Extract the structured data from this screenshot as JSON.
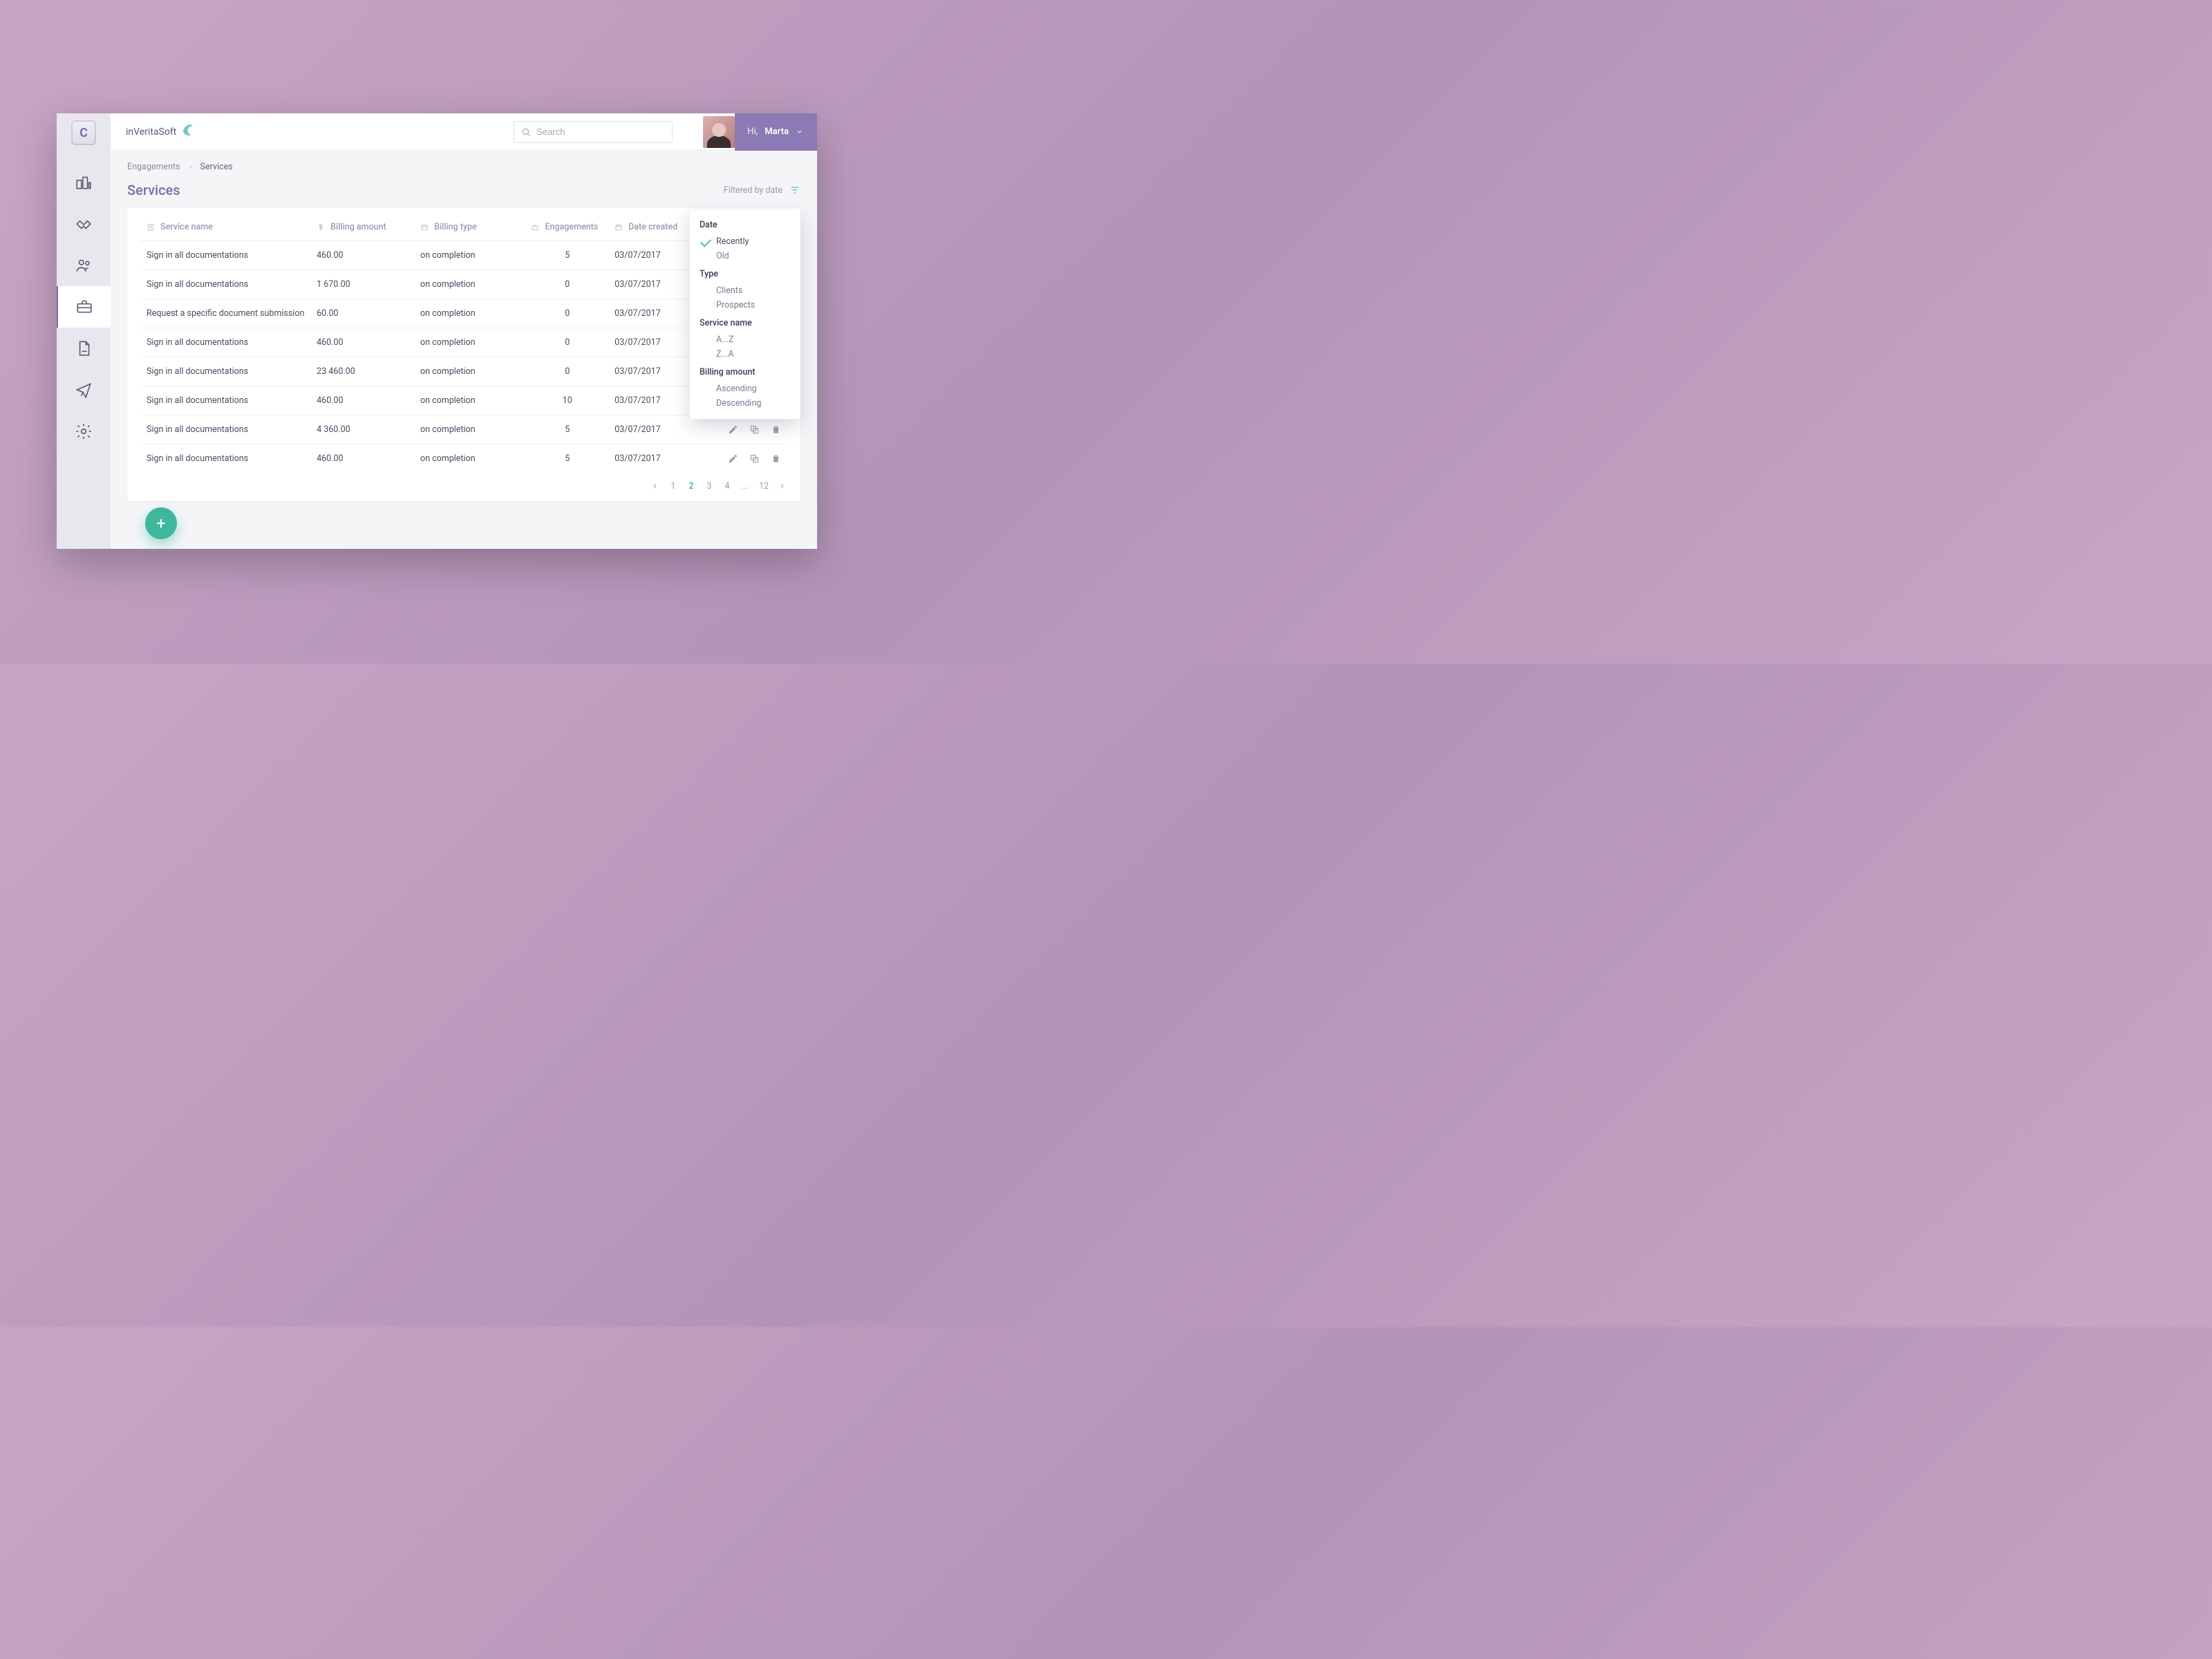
{
  "brand": {
    "name": "inVeritaSoft"
  },
  "search": {
    "placeholder": "Search"
  },
  "user": {
    "greeting": "Hi,",
    "name": "Marta"
  },
  "breadcrumb": {
    "parent": "Engagements",
    "current": "Services"
  },
  "page": {
    "title": "Services"
  },
  "filter": {
    "trigger_label": "Filtered by date",
    "groups": [
      {
        "label": "Date",
        "options": [
          "Recently",
          "Old"
        ],
        "selected": "Recently"
      },
      {
        "label": "Type",
        "options": [
          "Clients",
          "Prospects"
        ],
        "selected": null
      },
      {
        "label": "Service name",
        "options": [
          "A...Z",
          "Z...A"
        ],
        "selected": null
      },
      {
        "label": "Billing amount",
        "options": [
          "Ascending",
          "Descending"
        ],
        "selected": null
      }
    ]
  },
  "table": {
    "columns": {
      "service_name": "Service name",
      "billing_amount": "Billing amount",
      "billing_type": "Billing type",
      "engagements": "Engagements",
      "date_created": "Date created"
    },
    "rows": [
      {
        "service_name": "Sign in all documentations",
        "billing_amount": "460.00",
        "billing_type": "on completion",
        "engagements": "5",
        "date_created": "03/07/2017"
      },
      {
        "service_name": "Sign in all documentations",
        "billing_amount": "1 670.00",
        "billing_type": "on completion",
        "engagements": "0",
        "date_created": "03/07/2017"
      },
      {
        "service_name": "Request a specific document submission",
        "billing_amount": "60.00",
        "billing_type": "on completion",
        "engagements": "0",
        "date_created": "03/07/2017"
      },
      {
        "service_name": "Sign in all documentations",
        "billing_amount": "460.00",
        "billing_type": "on completion",
        "engagements": "0",
        "date_created": "03/07/2017"
      },
      {
        "service_name": "Sign in all documentations",
        "billing_amount": "23 460.00",
        "billing_type": "on completion",
        "engagements": "0",
        "date_created": "03/07/2017"
      },
      {
        "service_name": "Sign in all documentations",
        "billing_amount": "460.00",
        "billing_type": "on completion",
        "engagements": "10",
        "date_created": "03/07/2017"
      },
      {
        "service_name": "Sign in all documentations",
        "billing_amount": "4 360.00",
        "billing_type": "on completion",
        "engagements": "5",
        "date_created": "03/07/2017"
      },
      {
        "service_name": "Sign in all documentations",
        "billing_amount": "460.00",
        "billing_type": "on completion",
        "engagements": "5",
        "date_created": "03/07/2017"
      }
    ]
  },
  "pagination": {
    "pages": [
      "1",
      "2",
      "3",
      "4",
      "...",
      "12"
    ],
    "active": "2"
  },
  "sidebar": {
    "items": [
      "city",
      "handshake",
      "people",
      "briefcase",
      "document",
      "paper-plane",
      "gear"
    ],
    "active": "briefcase"
  },
  "colors": {
    "accent_purple": "#7a6fa3",
    "accent_teal": "#3fb79d"
  }
}
